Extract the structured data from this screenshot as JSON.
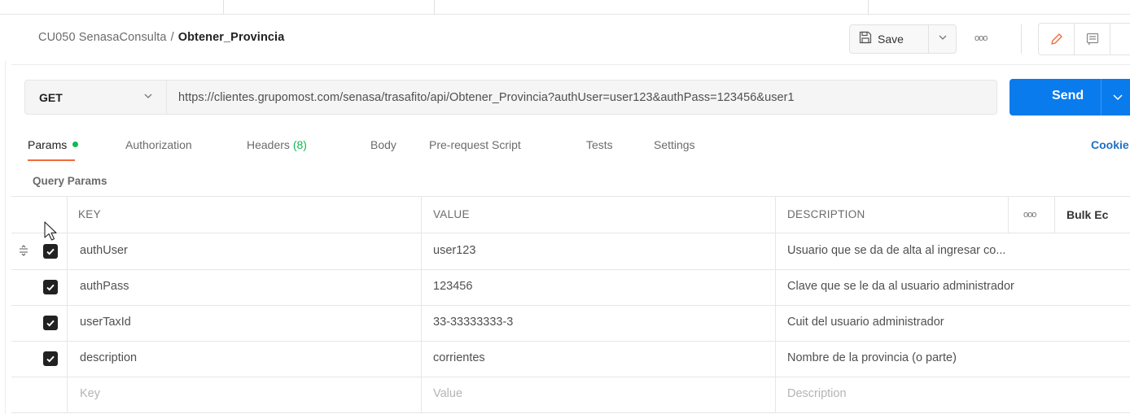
{
  "header": {
    "collection": "CU050 SenasaConsulta",
    "separator": "/",
    "request_name": "Obtener_Provincia",
    "save_label": "Save",
    "more_label": "ooo"
  },
  "request": {
    "method": "GET",
    "url": "https://clientes.grupomost.com/senasa/trasafito/api/Obtener_Provincia?authUser=user123&authPass=123456&user1",
    "send_label": "Send"
  },
  "tabs": [
    {
      "label": "Params",
      "active": true,
      "dot": true
    },
    {
      "label": "Authorization"
    },
    {
      "label": "Headers",
      "count": "(8)"
    },
    {
      "label": "Body"
    },
    {
      "label": "Pre-request Script"
    },
    {
      "label": "Tests"
    },
    {
      "label": "Settings"
    }
  ],
  "cookies_label": "Cookie",
  "query_params_label": "Query Params",
  "table": {
    "headers": {
      "key": "KEY",
      "value": "VALUE",
      "description": "DESCRIPTION",
      "more": "ooo",
      "bulk_edit": "Bulk Ec"
    },
    "rows": [
      {
        "key": "authUser",
        "value": "user123",
        "description": "Usuario que se da de alta al ingresar co...",
        "checked": true
      },
      {
        "key": "authPass",
        "value": "123456",
        "description": "Clave que se le da al usuario administrador",
        "checked": true
      },
      {
        "key": "userTaxId",
        "value": "33-33333333-3",
        "description": "Cuit del usuario administrador",
        "checked": true
      },
      {
        "key": "description",
        "value": "corrientes",
        "description": "Nombre de la provincia (o parte)",
        "checked": true
      }
    ],
    "placeholders": {
      "key": "Key",
      "value": "Value",
      "description": "Description"
    }
  },
  "colors": {
    "send": "#097bed",
    "tab_underline": "#f26b3a",
    "params_dot": "#0cbb52",
    "cookies": "#1f6fc5"
  },
  "icons": [
    "save-icon",
    "chevron-down-icon",
    "more-icon",
    "edit-pencil-icon",
    "comment-icon",
    "checkbox-checked-icon",
    "drag-handle-icon",
    "mouse-cursor-icon"
  ]
}
